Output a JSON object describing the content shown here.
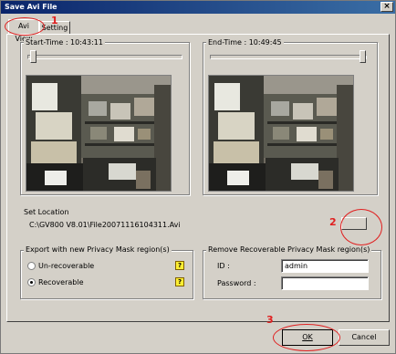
{
  "window": {
    "title": "Save Avi File",
    "close_glyph": "×"
  },
  "tabs": [
    {
      "label": "Avi View",
      "selected": true
    },
    {
      "label": "Setting",
      "selected": false
    }
  ],
  "start": {
    "label": "Start-Time : 10:43:11",
    "slider_position": 0
  },
  "end": {
    "label": "End-Time : 10:49:45",
    "slider_position": 1
  },
  "location": {
    "label": "Set Location",
    "path": "C:\\GV800 V8.01\\File20071116104311.Avi",
    "browse_label": ""
  },
  "export_group": {
    "label": "Export with new Privacy Mask region(s)",
    "options": [
      {
        "label": "Un-recoverable",
        "selected": false
      },
      {
        "label": "Recoverable",
        "selected": true
      }
    ],
    "help_glyph": "?"
  },
  "remove_group": {
    "label": "Remove Recoverable Privacy Mask region(s)",
    "id_label": "ID :",
    "id_value": "admin",
    "password_label": "Password :",
    "password_value": ""
  },
  "buttons": {
    "ok": "OK",
    "cancel": "Cancel"
  },
  "annotations": {
    "color": "#e02020",
    "marks": [
      "1",
      "2",
      "3"
    ]
  }
}
